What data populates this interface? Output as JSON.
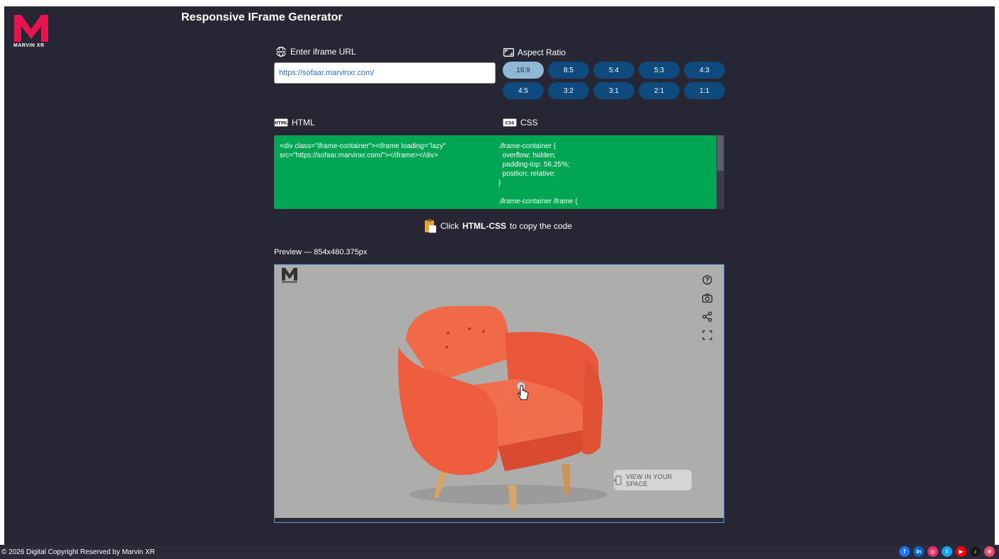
{
  "brand": {
    "logo_text": "MARVIN XR",
    "logo_color": "#e5154f"
  },
  "page": {
    "title": "Responsive IFrame Generator"
  },
  "url": {
    "label": "Enter iframe URL",
    "value": "https://sofaar.marvinxr.com/"
  },
  "aspect": {
    "label": "Aspect Ratio",
    "active": "16:9",
    "options": [
      "16:9",
      "8:5",
      "5:4",
      "5:3",
      "4:3",
      "4:5",
      "3:2",
      "3:1",
      "2:1",
      "1:1"
    ]
  },
  "html_panel": {
    "label": "HTML",
    "icon_text": "HTML",
    "code": "<div class=\"iframe-container\"><iframe loading=\"lazy\" src=\"https://sofaar.marvinxr.com/\"></iframe></div>"
  },
  "css_panel": {
    "label": "CSS",
    "icon_text": "CSS",
    "code": ".iframe-container {\n  overflow: hidden;\n  padding-top: 56.25%;\n  position: relative;\n}\n\n.iframe-container iframe {"
  },
  "copy_hint": {
    "prefix": "Click",
    "bold": "HTML-CSS",
    "suffix": "to copy the code"
  },
  "preview": {
    "label": "Preview — 854x480.375px",
    "ar_button": "VIEW IN YOUR SPACE",
    "tool_icons": [
      "help-icon",
      "camera-icon",
      "share-icon",
      "fullscreen-icon"
    ]
  },
  "footer": {
    "copyright": "© 2026 Digital Copyright Reserved by Marvin XR",
    "socials": [
      {
        "name": "facebook",
        "glyph": "f",
        "color": "#1877f2"
      },
      {
        "name": "linkedin",
        "glyph": "in",
        "color": "#0a66c2"
      },
      {
        "name": "instagram",
        "glyph": "◎",
        "color": "#e1306c"
      },
      {
        "name": "twitter",
        "glyph": "t",
        "color": "#1da1f2"
      },
      {
        "name": "youtube",
        "glyph": "▶",
        "color": "#ff0000"
      },
      {
        "name": "tiktok",
        "glyph": "♪",
        "color": "#1a1a1a"
      },
      {
        "name": "website",
        "glyph": "⊕",
        "color": "#e94b6a"
      }
    ]
  }
}
